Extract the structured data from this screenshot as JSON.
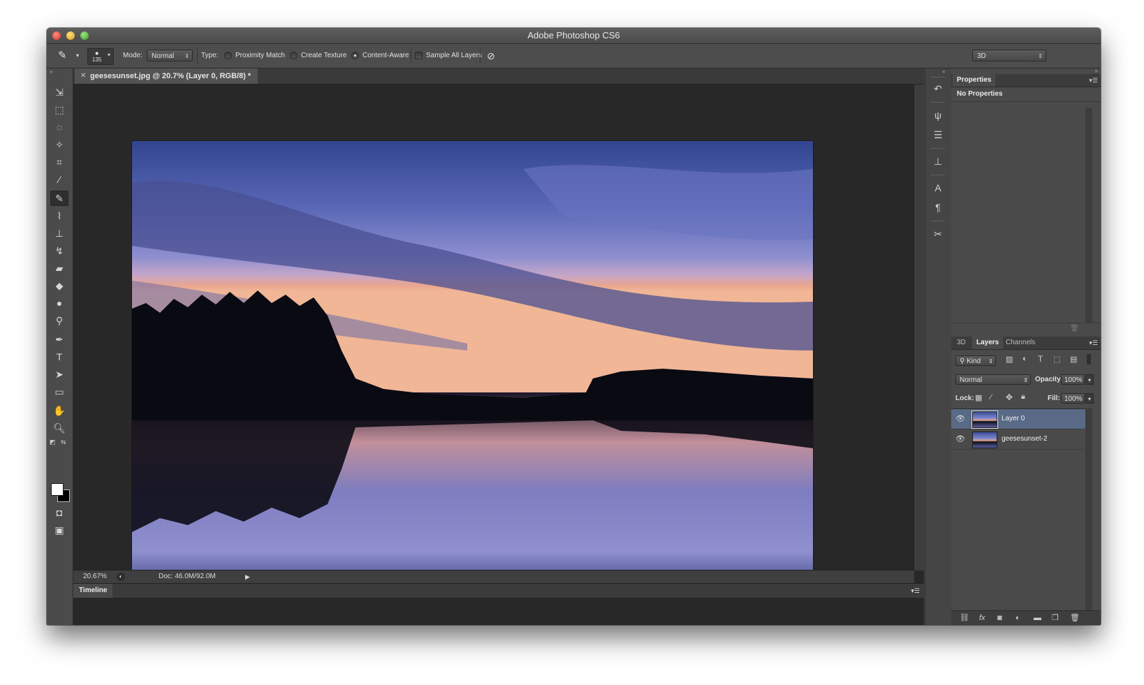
{
  "window": {
    "title": "Adobe Photoshop CS6"
  },
  "options_bar": {
    "brush_size": "135",
    "mode_label": "Mode:",
    "mode_value": "Normal",
    "type_label": "Type:",
    "radio_proximity": "Proximity Match",
    "radio_texture": "Create Texture",
    "radio_content": "Content-Aware",
    "sample_all_layers": "Sample All Layers",
    "workspace": "3D"
  },
  "document": {
    "tab_title": "geesesunset.jpg @ 20.7% (Layer 0, RGB/8) *",
    "zoom": "20.67%",
    "doc_size": "Doc: 46.0M/92.0M"
  },
  "timeline": {
    "label": "Timeline"
  },
  "properties_panel": {
    "tab": "Properties",
    "body": "No Properties"
  },
  "layers_panel": {
    "tabs": [
      "3D",
      "Layers",
      "Channels"
    ],
    "filter_kind": "Kind",
    "blend_mode": "Normal",
    "opacity_label": "Opacity:",
    "opacity_value": "100%",
    "lock_label": "Lock:",
    "fill_label": "Fill:",
    "fill_value": "100%",
    "layers": [
      {
        "name": "Layer 0",
        "selected": true
      },
      {
        "name": "geesesunset-2",
        "selected": false
      }
    ]
  },
  "colors": {
    "foreground": "#ffffff",
    "background": "#000000",
    "selection": "#586a86"
  }
}
